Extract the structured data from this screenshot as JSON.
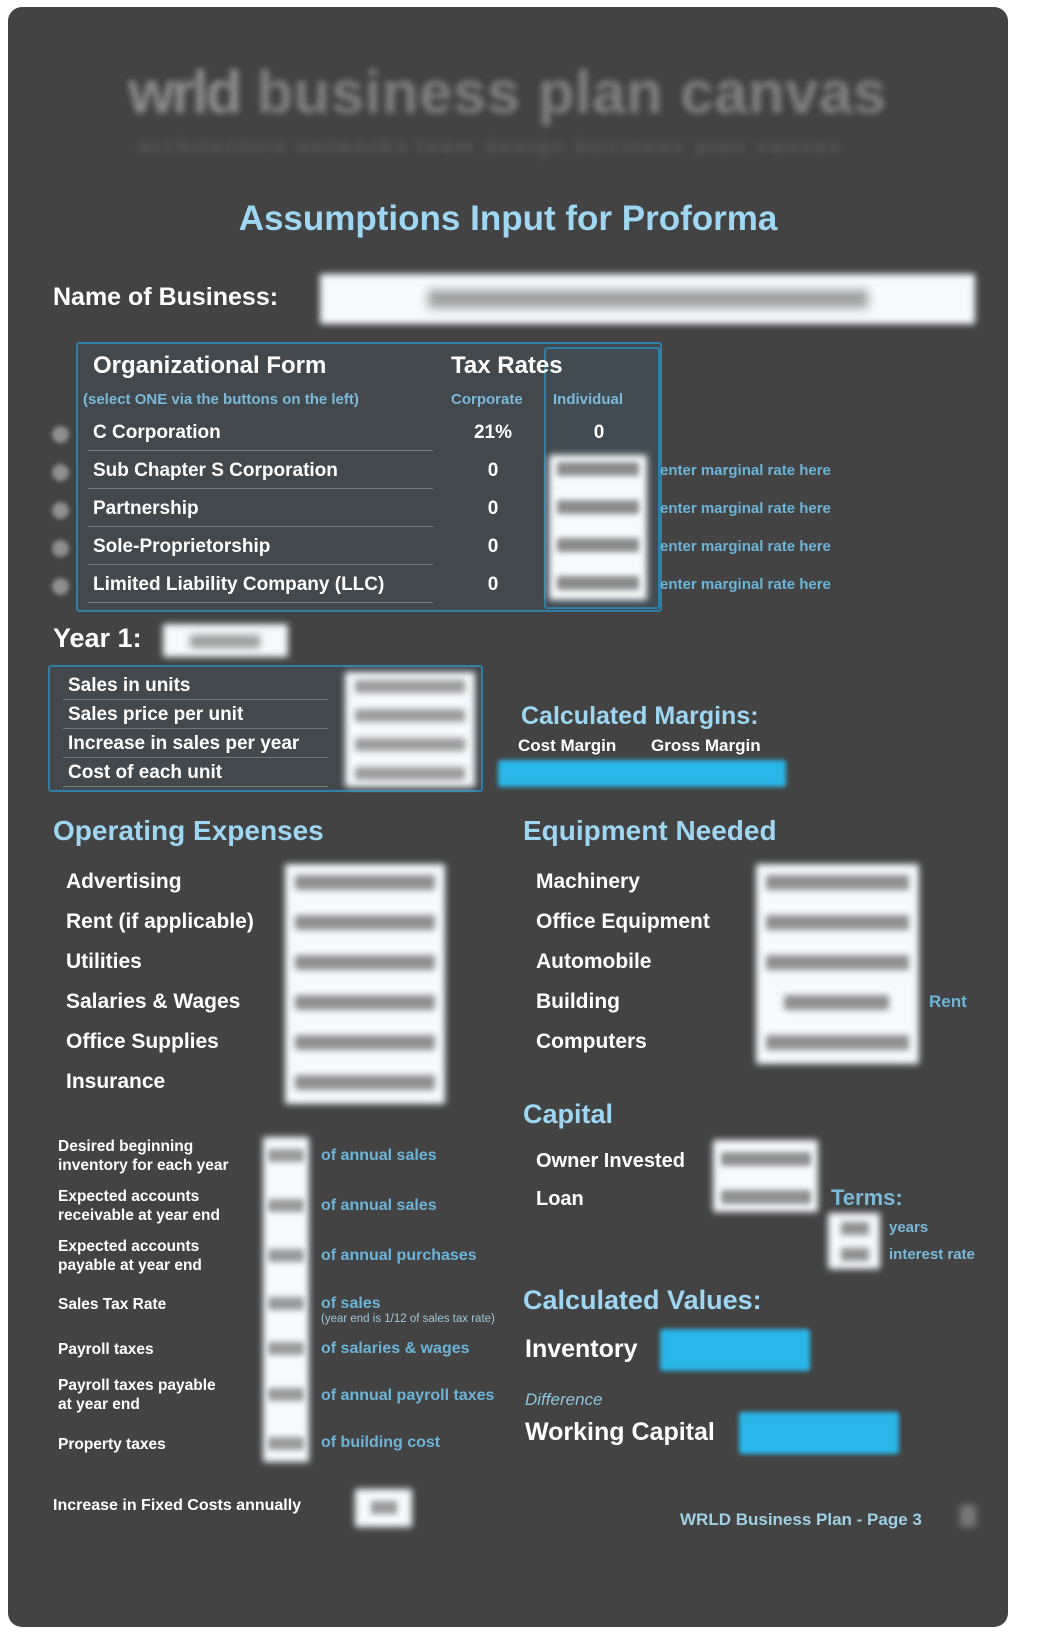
{
  "logo": {
    "mark": "wrld",
    "wordmark": "business plan canvas",
    "tagline": "architecture  networks  team  design  business  plan  canvas"
  },
  "page_title": "Assumptions Input for Proforma",
  "business_name": {
    "label": "Name of Business:",
    "value": ""
  },
  "organizational_form": {
    "heading": "Organizational Form",
    "subheading": "(select ONE via the buttons on the left)",
    "tax_rates_heading": "Tax Rates",
    "columns": [
      "Corporate",
      "Individual"
    ],
    "rows": [
      {
        "name": "C Corporation",
        "corporate": "21%",
        "individual": "0",
        "note": ""
      },
      {
        "name": "Sub Chapter S Corporation",
        "corporate": "0",
        "individual": "",
        "note": "enter marginal rate here"
      },
      {
        "name": "Partnership",
        "corporate": "0",
        "individual": "",
        "note": "enter marginal rate here"
      },
      {
        "name": "Sole-Proprietorship",
        "corporate": "0",
        "individual": "",
        "note": "enter marginal rate here"
      },
      {
        "name": "Limited Liability Company (LLC)",
        "corporate": "0",
        "individual": "",
        "note": "enter marginal rate here"
      }
    ]
  },
  "year1": {
    "label": "Year 1:",
    "value": "",
    "rows": [
      "Sales in units",
      "Sales price per unit",
      "Increase in sales per year",
      "Cost of each unit"
    ]
  },
  "calculated_margins": {
    "title": "Calculated Margins:",
    "cost_margin_label": "Cost Margin",
    "gross_margin_label": "Gross Margin"
  },
  "operating_expenses": {
    "title": "Operating Expenses",
    "items": [
      "Advertising",
      "Rent (if applicable)",
      "Utilities",
      "Salaries & Wages",
      "Office Supplies",
      "Insurance"
    ]
  },
  "equipment_needed": {
    "title": "Equipment Needed",
    "items": [
      "Machinery",
      "Office Equipment",
      "Automobile",
      "Building",
      "Computers"
    ],
    "rent_note": "Rent"
  },
  "percent_assumptions": {
    "rows": [
      {
        "label": "Desired beginning\ninventory for each year",
        "note": "of annual sales",
        "subnote": ""
      },
      {
        "label": "Expected accounts\nreceivable at year end",
        "note": "of annual sales",
        "subnote": ""
      },
      {
        "label": "Expected accounts\npayable at year end",
        "note": "of annual purchases",
        "subnote": ""
      },
      {
        "label": "Sales Tax Rate",
        "note": "of sales",
        "subnote": "(year end is 1/12 of sales tax rate)"
      },
      {
        "label": "Payroll taxes",
        "note": "of salaries & wages",
        "subnote": ""
      },
      {
        "label": "Payroll taxes payable\nat year end",
        "note": "of annual payroll taxes",
        "subnote": ""
      },
      {
        "label": "Property taxes",
        "note": "of building cost",
        "subnote": ""
      }
    ],
    "increase_fixed_costs_label": "Increase in Fixed Costs annually"
  },
  "capital": {
    "title": "Capital",
    "items": [
      "Owner Invested",
      "Loan"
    ],
    "terms_label": "Terms:",
    "years_label": "years",
    "interest_label": "interest rate"
  },
  "calculated_values": {
    "title": "Calculated Values:",
    "inventory_label": "Inventory",
    "difference_label": "Difference",
    "working_capital_label": "Working Capital"
  },
  "footer": "WRLD Business Plan - Page 3",
  "colors": {
    "background": "#434343",
    "accent_light_blue": "#9fd6f2",
    "accent_blue": "#7cb9d9",
    "highlight_cyan": "#29b6e8",
    "field_white": "#f6fafc",
    "border_blue": "#2f7ea6"
  }
}
